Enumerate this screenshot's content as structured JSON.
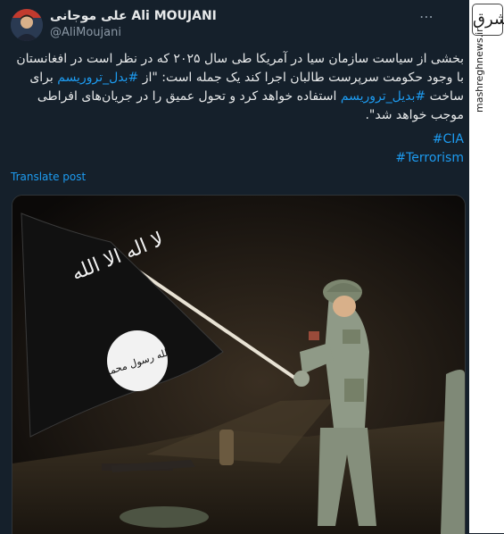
{
  "author": {
    "name": "علی موجانی Ali MOUJANI",
    "handle": "@AliMoujani"
  },
  "more_icon": "ellipsis-icon",
  "post": {
    "line1": "بخشی از سیاست سازمان سیا در آمریکا طی سال ۲۰۲۵ که در نظر است در افغانستان",
    "line2_a": "با وجود حکومت سرپرست طالبان اجرا کند یک جمله است: \"از ",
    "line2_tag": "#بدل_تروریسم",
    "line2_b": " برای",
    "line3_a": "ساخت ",
    "line3_tag": "#بدیل_تروریسم",
    "line3_b": " استفاده خواهد کرد و تحول عمیق را در جریان‌های افراطی",
    "line4": "موجب خواهد شد\".",
    "hashtags": [
      "#CIA",
      "#Terrorism"
    ]
  },
  "translate_label": "Translate post",
  "media": {
    "flag_text_top": "لا اله الا الله",
    "flag_seal_text": "الله رسول محمد"
  },
  "watermark": {
    "logo_text": "مشرق",
    "url": "mashreghnews.ir"
  },
  "colors": {
    "background": "#15202b",
    "link": "#1d9bf0",
    "text": "#e7e9ea",
    "muted": "#8b98a5"
  }
}
